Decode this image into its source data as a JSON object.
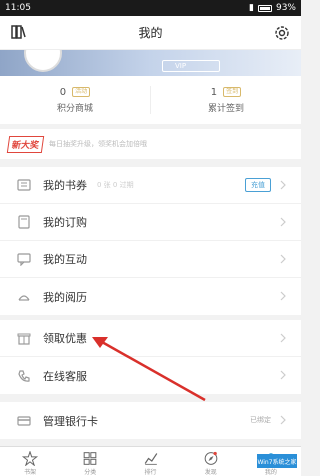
{
  "status": {
    "time": "11:05",
    "battery": "93%"
  },
  "header": {
    "title": "我的"
  },
  "banner": {
    "vip_label": "VIP"
  },
  "stats": [
    {
      "num": "0",
      "tag": "活动",
      "label": "积分商城"
    },
    {
      "num": "1",
      "tag": "签到",
      "label": "累计签到"
    }
  ],
  "promo": {
    "badge": "新大奖",
    "text": "每日抽奖升级，领奖机会加倍哦"
  },
  "menu_group1": [
    {
      "name": "coupon",
      "label": "我的书券",
      "value": "0 张 0 过期",
      "pill": "充值"
    },
    {
      "name": "subscription",
      "label": "我的订购"
    },
    {
      "name": "interaction",
      "label": "我的互动"
    },
    {
      "name": "history",
      "label": "我的阅历"
    }
  ],
  "menu_group2": [
    {
      "name": "offers",
      "label": "领取优惠"
    },
    {
      "name": "service",
      "label": "在线客服"
    }
  ],
  "menu_group3": [
    {
      "name": "bank-card",
      "label": "管理银行卡",
      "value": "已绑定"
    }
  ],
  "tabs": [
    {
      "label": "书架"
    },
    {
      "label": "分类"
    },
    {
      "label": "排行"
    },
    {
      "label": "发现"
    },
    {
      "label": "我的"
    }
  ],
  "watermark": "Win7系统之家"
}
